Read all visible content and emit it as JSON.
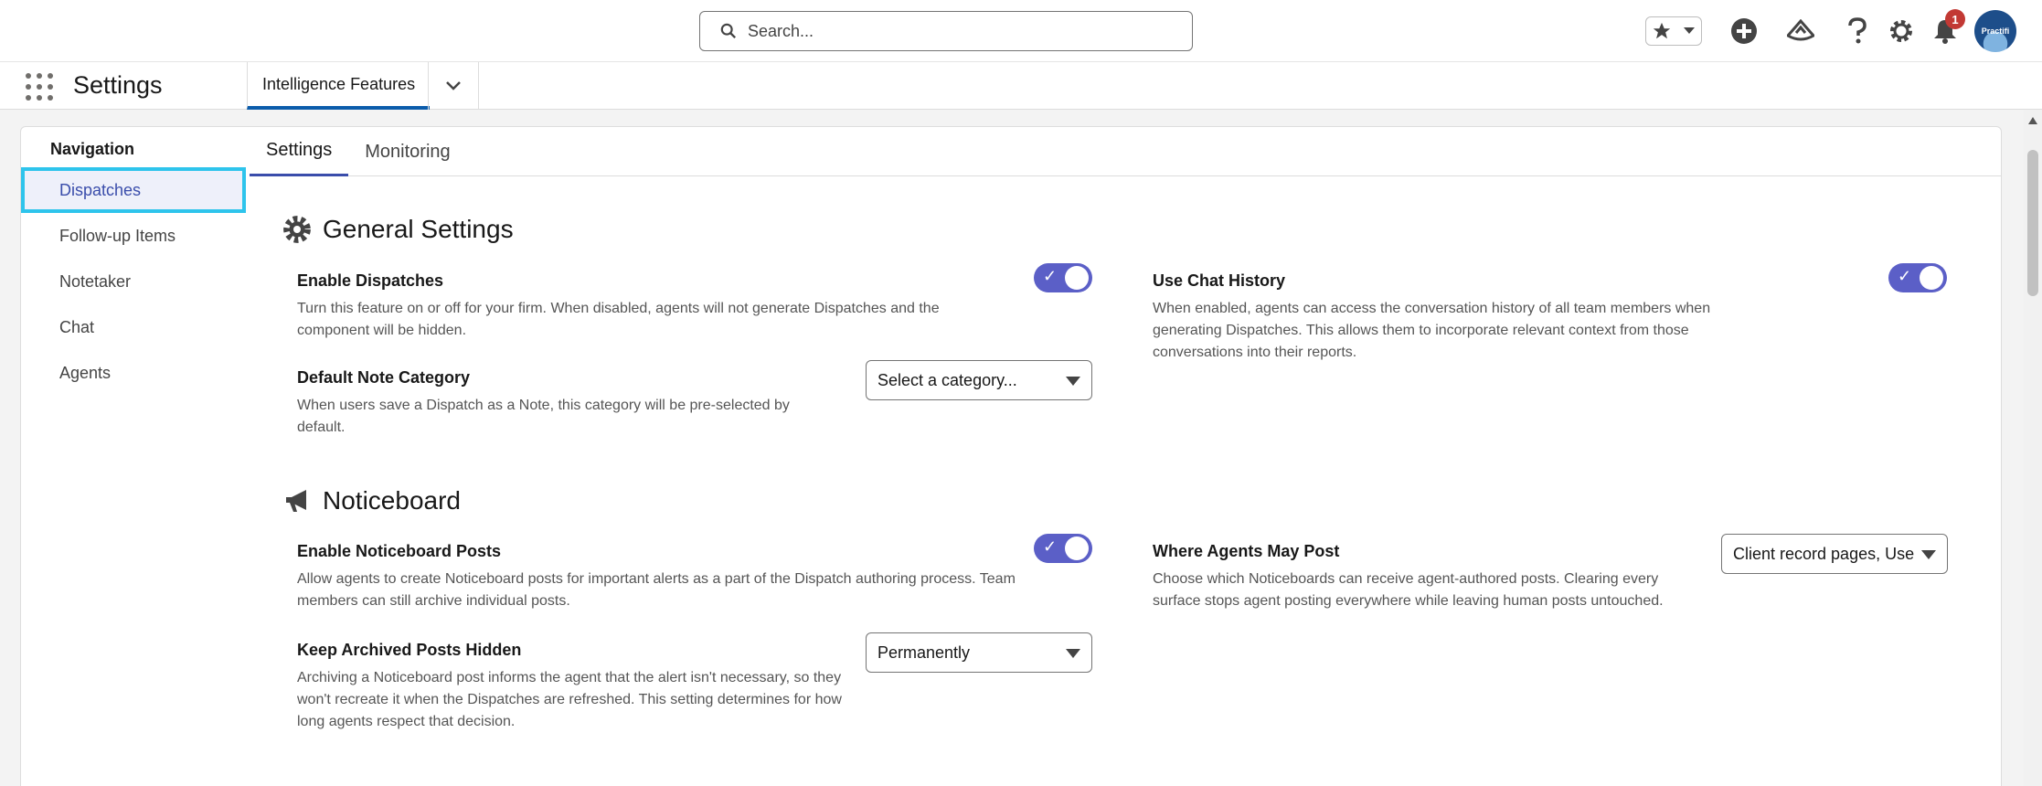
{
  "search": {
    "placeholder": "Search..."
  },
  "header": {
    "notifications_count": "1",
    "avatar_text": "Practifi"
  },
  "app": {
    "name": "Settings",
    "tab_label": "Intelligence Features"
  },
  "navigation": {
    "title": "Navigation",
    "items": [
      {
        "label": "Dispatches",
        "active": true
      },
      {
        "label": "Follow-up Items"
      },
      {
        "label": "Notetaker"
      },
      {
        "label": "Chat"
      },
      {
        "label": "Agents"
      }
    ]
  },
  "tabs": [
    {
      "label": "Settings",
      "active": true
    },
    {
      "label": "Monitoring"
    }
  ],
  "general": {
    "title": "General Settings",
    "enable_dispatches": {
      "label": "Enable Dispatches",
      "desc": "Turn this feature on or off for your firm. When disabled, agents will not generate Dispatches and the component will be hidden.",
      "on": true
    },
    "use_chat_history": {
      "label": "Use Chat History",
      "desc": "When enabled, agents can access the conversation history of all team members when generating Dispatches. This allows them to incorporate relevant context from those conversations into their reports.",
      "on": true
    },
    "default_note_category": {
      "label": "Default Note Category",
      "desc": "When users save a Dispatch as a Note, this category will be pre-selected by default.",
      "value": "Select a category..."
    }
  },
  "noticeboard": {
    "title": "Noticeboard",
    "enable_posts": {
      "label": "Enable Noticeboard Posts",
      "desc": "Allow agents to create Noticeboard posts for important alerts as a part of the Dispatch authoring process. Team members can still archive individual posts.",
      "on": true
    },
    "where_agents_post": {
      "label": "Where Agents May Post",
      "desc": "Choose which Noticeboards can receive agent-authored posts. Clearing every surface stops agent posting everywhere while leaving human posts untouched.",
      "value": "Client record pages, Use"
    },
    "keep_archived_hidden": {
      "label": "Keep Archived Posts Hidden",
      "desc": "Archiving a Noticeboard post informs the agent that the alert isn't necessary, so they won't recreate it when the Dispatches are refreshed. This setting determines for how long agents respect that decision.",
      "value": "Permanently"
    }
  },
  "colors": {
    "accent": "#5b5fc7",
    "highlight": "#2ec4ec",
    "active_text": "#3a4dab"
  }
}
